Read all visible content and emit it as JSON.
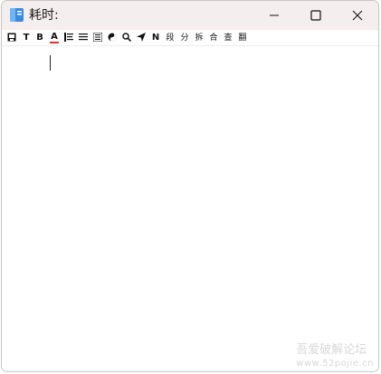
{
  "window": {
    "title": "耗时:"
  },
  "toolbar": {
    "text_items": {
      "t": "T",
      "b": "B",
      "a": "A",
      "n": "N",
      "duan": "段",
      "fen": "分",
      "chai": "拆",
      "he": "合",
      "cha": "查",
      "fan": "翻"
    },
    "icons": [
      "save-icon",
      "title-icon",
      "bold-icon",
      "font-color-icon",
      "align-indent-icon",
      "align-justify-icon",
      "paragraph-block-icon",
      "theme-icon",
      "search-icon",
      "send-icon"
    ],
    "colors": {
      "font_color_underline": "#e03030"
    }
  },
  "editor": {
    "content": ""
  },
  "watermark": {
    "line1": "吾爱破解论坛",
    "line2": "www.52pojie.cn"
  },
  "colors": {
    "titlebar_bg": "#f5eeee",
    "window_border": "#c9c4c4",
    "icon_blue": "#3a7bd5"
  }
}
